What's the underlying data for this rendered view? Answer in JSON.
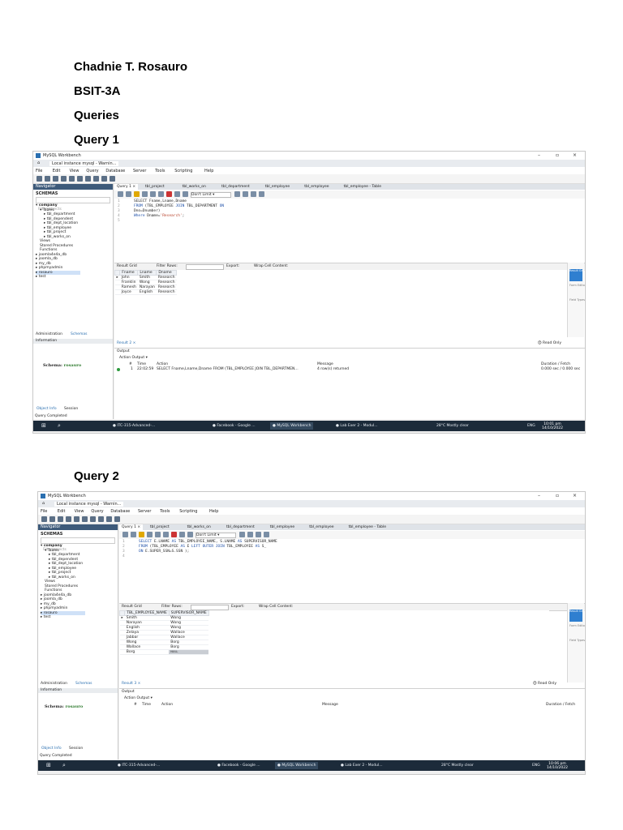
{
  "headings": {
    "name": "Chadnie T. Rosauro",
    "section": "BSIT-3A",
    "topic": "Queries",
    "query1": "Query 1",
    "query2": "Query 2"
  },
  "workbench": {
    "app_title": "MySQL Workbench",
    "connection_tab": "Local instance mysql - Warnin...",
    "menu": [
      "File",
      "Edit",
      "View",
      "Query",
      "Database",
      "Server",
      "Tools",
      "Scripting",
      "Help"
    ],
    "navigator_label": "Navigator",
    "schemas_label": "SCHEMAS",
    "filter_placeholder": "Filter objects",
    "tree": {
      "company": "company",
      "tables": "Tables",
      "table_items": [
        "tbl_department",
        "tbl_dependent",
        "tbl_dept_location",
        "tbl_employee",
        "tbl_project",
        "tbl_works_on"
      ],
      "views": "Views",
      "stored_procedures": "Stored Procedures",
      "functions": "Functions",
      "other_schemas": [
        "joomla4e4a_db",
        "joomla_db",
        "my_db",
        "phpmyadmin",
        "rosauro",
        "test"
      ]
    },
    "admin_tab": "Administration",
    "schemas_tab": "Schemas",
    "information_label": "Information",
    "schema_label": "Schema:",
    "schema_value": "rosauro",
    "object_info": "Object Info",
    "session": "Session",
    "limit_label": "Don't Limit",
    "editor_tabs_1": [
      "Query 1",
      "tbl_project",
      "tbl_works_on",
      "tbl_department",
      "tbl_employee",
      "tbl_employee",
      "tbl_employee - Table"
    ],
    "editor_tabs_2": [
      "Query 1",
      "tbl_project",
      "tbl_works_on",
      "tbl_department",
      "tbl_employee",
      "tbl_employee",
      "tbl_employee - Table"
    ],
    "result_grid_label": "Result Grid",
    "filter_rows_label": "Filter Rows:",
    "export_label": "Export:",
    "wrap_label": "Wrap Cell Content:",
    "side_buttons": [
      "Result Grid",
      "Form Editor",
      "Field Types"
    ],
    "read_only": "Read Only",
    "output_label": "Output",
    "action_output": "Action Output",
    "output_headers": [
      "#",
      "Time",
      "Action",
      "Message",
      "Duration / Fetch"
    ],
    "query_completed": "Query Completed"
  },
  "query1": {
    "code": [
      {
        "num": "1",
        "parts": [
          {
            "t": "SELECT Fname,Lname,Dname",
            "c": ""
          }
        ]
      },
      {
        "num": "2",
        "parts": [
          {
            "t": "FROM",
            "c": "kw"
          },
          {
            "t": " (TBL_EMPLOYEE ",
            "c": ""
          },
          {
            "t": "JOIN",
            "c": "kw"
          },
          {
            "t": " TBL_DEPARTMENT ",
            "c": ""
          },
          {
            "t": "ON",
            "c": "kw"
          }
        ]
      },
      {
        "num": "3",
        "parts": [
          {
            "t": "Dno=Dnumber)",
            "c": ""
          }
        ]
      },
      {
        "num": "4",
        "parts": [
          {
            "t": "Where",
            "c": "kw"
          },
          {
            "t": " Dname=",
            "c": ""
          },
          {
            "t": "'Research'",
            "c": "str"
          },
          {
            "t": ";",
            "c": ""
          }
        ]
      },
      {
        "num": "5",
        "parts": [
          {
            "t": "",
            "c": ""
          }
        ]
      }
    ],
    "columns": [
      "Fname",
      "Lname",
      "Dname"
    ],
    "rows": [
      [
        "John",
        "Smith",
        "Research"
      ],
      [
        "Franklin",
        "Wong",
        "Research"
      ],
      [
        "Ramesh",
        "Narayan",
        "Research"
      ],
      [
        "Joyce",
        "English",
        "Research"
      ]
    ],
    "result_tab": "Result 2",
    "log": {
      "num": "1",
      "time": "22:02:59",
      "action": "SELECT Fname,Lname,Dname FROM (TBL_EMPLOYEE JOIN TBL_DEPARTMEN...",
      "message": "4 row(s) returned",
      "duration": "0.000 sec / 0.000 sec"
    },
    "taskbar": {
      "items": [
        "ITC-315-Advanced-...",
        "Facebook - Google ...",
        "MySQL Workbench",
        "Lab Exer 2 - Modul..."
      ],
      "weather": "28°C  Mostly clear",
      "lang": "ENG",
      "time": "10:01 pm",
      "date": "14/10/2022"
    }
  },
  "query2": {
    "code": [
      {
        "num": "1",
        "parts": [
          {
            "t": "SELECT",
            "c": "kw"
          },
          {
            "t": " E.LNAME ",
            "c": ""
          },
          {
            "t": "AS",
            "c": "kw"
          },
          {
            "t": " TBL_EMPLOYEE_NAME, S.LNAME ",
            "c": ""
          },
          {
            "t": "AS",
            "c": "kw"
          },
          {
            "t": " SUPERVISOR_NAME",
            "c": ""
          }
        ]
      },
      {
        "num": "2",
        "parts": [
          {
            "t": "FROM",
            "c": "kw"
          },
          {
            "t": " (TBL_EMPLOYEE ",
            "c": ""
          },
          {
            "t": "AS",
            "c": "kw"
          },
          {
            "t": " E ",
            "c": ""
          },
          {
            "t": "LEFT OUTER JOIN",
            "c": "kw"
          },
          {
            "t": " TBL_EMPLOYEE ",
            "c": ""
          },
          {
            "t": "AS",
            "c": "kw"
          },
          {
            "t": " S_",
            "c": ""
          }
        ]
      },
      {
        "num": "3",
        "parts": [
          {
            "t": "ON",
            "c": "kw"
          },
          {
            "t": " E.SUPER_SSN=S.SSN );",
            "c": ""
          }
        ]
      },
      {
        "num": "4",
        "parts": [
          {
            "t": "",
            "c": ""
          }
        ]
      }
    ],
    "columns": [
      "TBL_EMPLOYEE_NAME",
      "SUPERVISOR_NAME"
    ],
    "rows": [
      [
        "Smith",
        "Wong"
      ],
      [
        "Narayan",
        "Wong"
      ],
      [
        "English",
        "Wong"
      ],
      [
        "Zelaya",
        "Wallace"
      ],
      [
        "Jabbar",
        "Wallace"
      ],
      [
        "Wong",
        "Borg"
      ],
      [
        "Wallace",
        "Borg"
      ],
      [
        "Borg",
        "NULL"
      ]
    ],
    "result_tab": "Result 3",
    "taskbar": {
      "items": [
        "ITC-315-Advanced-...",
        "Facebook - Google ...",
        "MySQL Workbench",
        "Lab Exer 2 - Modul..."
      ],
      "weather": "28°C  Mostly clear",
      "lang": "ENG",
      "time": "10:06 pm",
      "date": "14/10/2022"
    }
  }
}
